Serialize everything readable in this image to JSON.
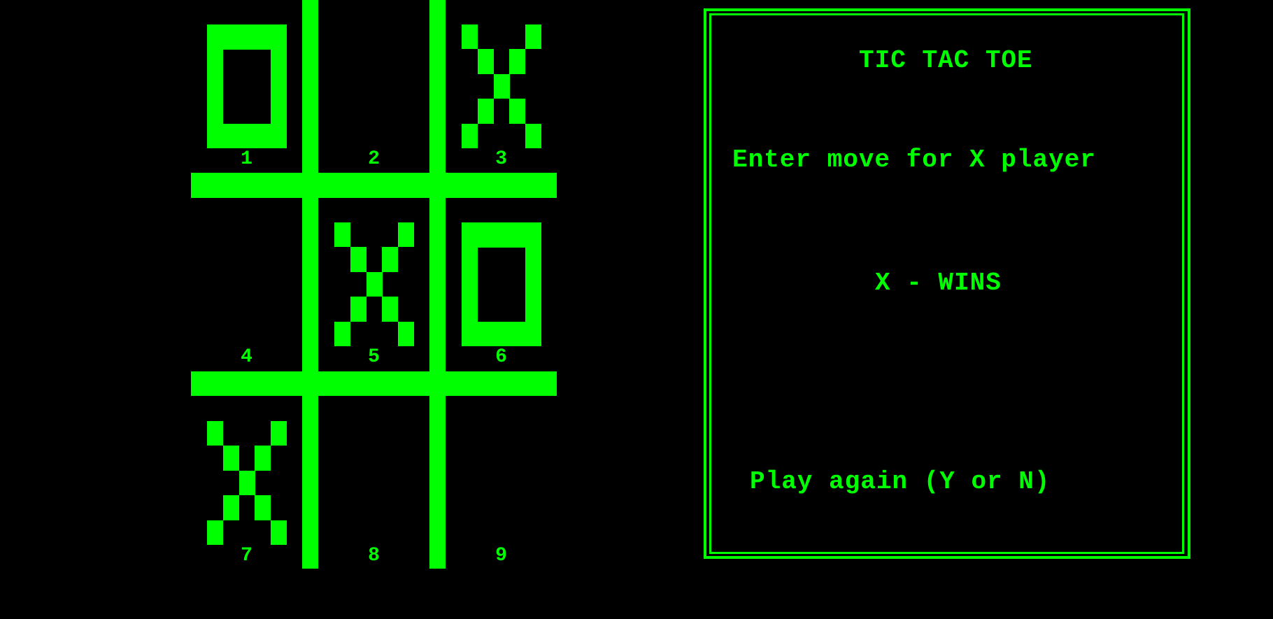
{
  "game": {
    "title": "TIC TAC TOE",
    "prompt": "Enter move for X player",
    "result": "X - WINS",
    "play_again_prompt": "Play again (Y or N)"
  },
  "theme": {
    "foreground": "#00ff00",
    "background": "#000000"
  },
  "board": {
    "cells": [
      {
        "number": "1",
        "mark": "O"
      },
      {
        "number": "2",
        "mark": ""
      },
      {
        "number": "3",
        "mark": "X"
      },
      {
        "number": "4",
        "mark": ""
      },
      {
        "number": "5",
        "mark": "X"
      },
      {
        "number": "6",
        "mark": "O"
      },
      {
        "number": "7",
        "mark": "X"
      },
      {
        "number": "8",
        "mark": ""
      },
      {
        "number": "9",
        "mark": ""
      }
    ]
  }
}
